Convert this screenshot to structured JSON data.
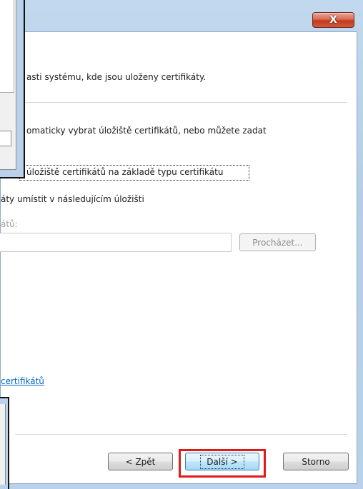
{
  "titlebar": {
    "close_label": "X"
  },
  "content": {
    "intro_text": "asti systému, kde jsou uloženy certifikáty.",
    "desc_text": "omaticky vybrat úložiště certifikátů, nebo můžete zadat",
    "option_auto_label": "úložiště certifikátů na základě typu certifikátu",
    "option_manual_label": "áty umístit v následujícím úložišti",
    "store_label": "átů:",
    "store_value": "",
    "browse_label": "Procházet...",
    "learn_more_link": "certifikátů"
  },
  "footer": {
    "back_label": "< Zpět",
    "next_label": "Další >",
    "cancel_label": "Storno"
  },
  "colors": {
    "frame": "#b9d1ea",
    "link": "#0066cc",
    "highlight": "#e01919"
  }
}
